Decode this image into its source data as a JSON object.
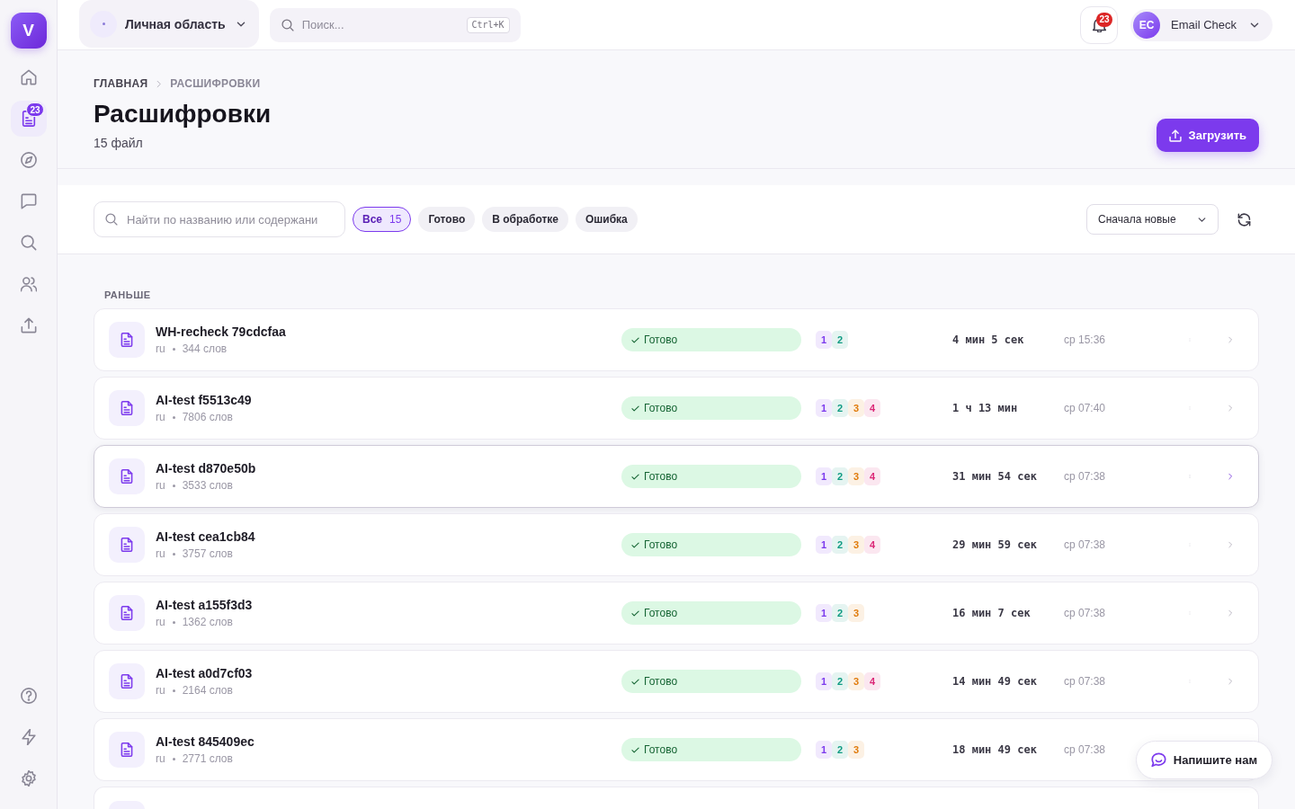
{
  "sidebar": {
    "logo": "V",
    "items": [
      {
        "selected": false
      },
      {
        "selected": true,
        "badge": "23"
      },
      {
        "selected": false
      },
      {
        "selected": false
      },
      {
        "selected": false
      },
      {
        "selected": false
      },
      {
        "selected": false
      }
    ],
    "bottom_items": [
      {
        "selected": false
      },
      {
        "selected": false
      },
      {
        "selected": false
      }
    ]
  },
  "topbar": {
    "workspace": {
      "label": "Личная область"
    },
    "search": {
      "placeholder": "Поиск...",
      "shortcut": "Ctrl+K"
    },
    "notifications": {
      "badge": "23"
    },
    "user": {
      "initials": "EC",
      "name": "Email Check"
    }
  },
  "header": {
    "breadcrumbs": [
      {
        "label": "ГЛАВНАЯ",
        "current": false
      },
      {
        "label": "РАСШИФРОВКИ",
        "current": true
      }
    ],
    "title": "Расшифровки",
    "subtitle": "15 файл",
    "upload_button": "Загрузить"
  },
  "filters": {
    "search": {
      "placeholder": "Найти по названию или содержани"
    },
    "chips": [
      {
        "label": "Все",
        "count": "15",
        "selected": true
      },
      {
        "label": "Готово",
        "selected": false
      },
      {
        "label": "В обработке",
        "selected": false
      },
      {
        "label": "Ошибка",
        "selected": false
      }
    ],
    "sort": {
      "value": "Сначала новые"
    }
  },
  "list": {
    "section": "РАНЬШЕ",
    "rows": [
      {
        "kind": "file",
        "name": "WH-recheck 79cdcfaa",
        "lang": "ru",
        "words": "344 слов",
        "status": "Готово",
        "speakers": [
          {
            "label": "1",
            "color": "#7c3aed"
          },
          {
            "label": "2",
            "color": "#0f9b82"
          }
        ],
        "duration": "4 мин 5 сек",
        "date": "ср 15:36",
        "highlighted": false
      },
      {
        "kind": "file",
        "name": "AI-test f5513c49",
        "lang": "ru",
        "words": "7806 слов",
        "status": "Готово",
        "speakers": [
          {
            "label": "1",
            "color": "#7c3aed"
          },
          {
            "label": "2",
            "color": "#0f9b82"
          },
          {
            "label": "3",
            "color": "#e07b0c"
          },
          {
            "label": "4",
            "color": "#db2777"
          }
        ],
        "duration": "1 ч 13 мин",
        "date": "ср 07:40",
        "highlighted": false
      },
      {
        "kind": "file",
        "name": "AI-test d870e50b",
        "lang": "ru",
        "words": "3533 слов",
        "status": "Готово",
        "speakers": [
          {
            "label": "1",
            "color": "#7c3aed"
          },
          {
            "label": "2",
            "color": "#0f9b82"
          },
          {
            "label": "3",
            "color": "#e07b0c"
          },
          {
            "label": "4",
            "color": "#db2777"
          }
        ],
        "duration": "31 мин 54 сек",
        "date": "ср 07:38",
        "highlighted": true
      },
      {
        "kind": "file",
        "name": "AI-test cea1cb84",
        "lang": "ru",
        "words": "3757 слов",
        "status": "Готово",
        "speakers": [
          {
            "label": "1",
            "color": "#7c3aed"
          },
          {
            "label": "2",
            "color": "#0f9b82"
          },
          {
            "label": "3",
            "color": "#e07b0c"
          },
          {
            "label": "4",
            "color": "#db2777"
          }
        ],
        "duration": "29 мин 59 сек",
        "date": "ср 07:38",
        "highlighted": false
      },
      {
        "kind": "file",
        "name": "AI-test a155f3d3",
        "lang": "ru",
        "words": "1362 слов",
        "status": "Готово",
        "speakers": [
          {
            "label": "1",
            "color": "#7c3aed"
          },
          {
            "label": "2",
            "color": "#0f9b82"
          },
          {
            "label": "3",
            "color": "#e07b0c"
          }
        ],
        "duration": "16 мин 7 сек",
        "date": "ср 07:38",
        "highlighted": false
      },
      {
        "kind": "file",
        "name": "AI-test a0d7cf03",
        "lang": "ru",
        "words": "2164 слов",
        "status": "Готово",
        "speakers": [
          {
            "label": "1",
            "color": "#7c3aed"
          },
          {
            "label": "2",
            "color": "#0f9b82"
          },
          {
            "label": "3",
            "color": "#e07b0c"
          },
          {
            "label": "4",
            "color": "#db2777"
          }
        ],
        "duration": "14 мин 49 сек",
        "date": "ср 07:38",
        "highlighted": false
      },
      {
        "kind": "file",
        "name": "AI-test 845409ec",
        "lang": "ru",
        "words": "2771 слов",
        "status": "Готово",
        "speakers": [
          {
            "label": "1",
            "color": "#7c3aed"
          },
          {
            "label": "2",
            "color": "#0f9b82"
          },
          {
            "label": "3",
            "color": "#e07b0c"
          }
        ],
        "duration": "18 мин 49 сек",
        "date": "ср 07:38",
        "highlighted": false
      },
      {
        "kind": "clipped"
      }
    ]
  },
  "chat_button": {
    "label": "Напишите нам"
  }
}
